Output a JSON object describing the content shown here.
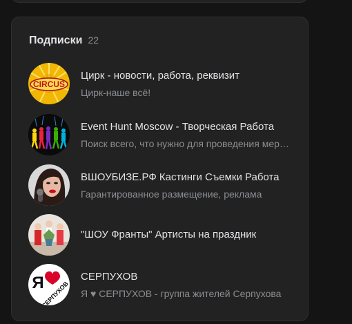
{
  "subscriptions": {
    "title": "Подписки",
    "count": "22",
    "items": [
      {
        "name": "Цирк - новости, работа, реквизит",
        "desc": "Цирк-наше всё!",
        "logo_text": "CIRCUS"
      },
      {
        "name": "Event Hunt Moscow - Творческая Работа",
        "desc": "Поиск всего, что нужно для проведения мероприятий"
      },
      {
        "name": "ВШОУБИЗЕ.РФ Кастинги Съемки Работа",
        "desc": "Гарантированное размещение, реклама"
      },
      {
        "name": "\"ШОУ Франты\" Артисты на праздник",
        "desc": ""
      },
      {
        "name": "СЕРПУХОВ",
        "desc": "Я ♥ СЕРПУХОВ - группа жителей Серпухова",
        "logo_text_1": "Я",
        "logo_text_2": "СЕРПУХОВ"
      }
    ]
  },
  "colors": {
    "background": "#141414",
    "card": "#222222",
    "text_primary": "#e1e3e6",
    "text_secondary": "#8a8d91"
  }
}
